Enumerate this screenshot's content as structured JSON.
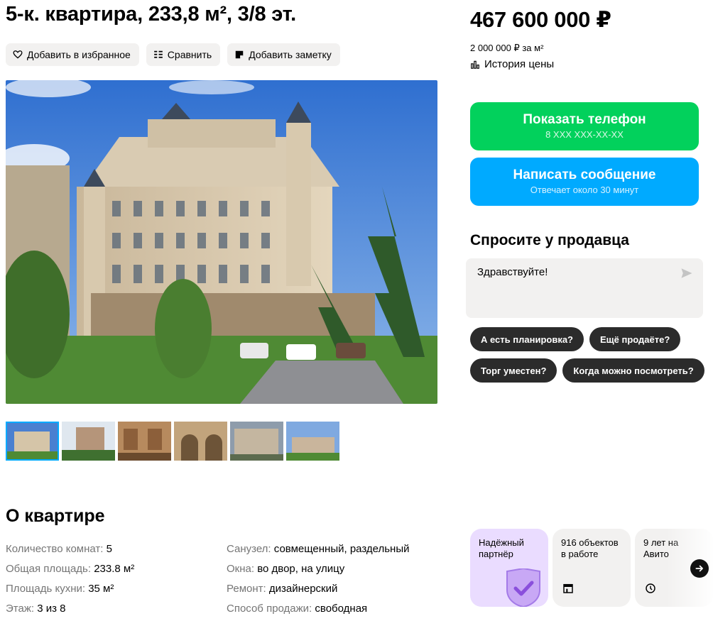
{
  "listing": {
    "title": "5-к. квартира, 233,8 м², 3/8 эт.",
    "actions": {
      "favorite": "Добавить в избранное",
      "compare": "Сравнить",
      "note": "Добавить заметку"
    }
  },
  "price": {
    "total": "467 600 000 ₽",
    "per_m2": "2 000 000 ₽ за м²",
    "history_link": "История цены"
  },
  "contact": {
    "phone_label": "Показать телефон",
    "phone_masked": "8 XXX XXX-XX-XX",
    "message_label": "Написать сообщение",
    "message_sub": "Отвечает около 30 минут"
  },
  "ask": {
    "title": "Спросите у продавца",
    "message_value": "Здравствуйте!",
    "quick_replies": [
      "А есть планировка?",
      "Ещё продаёте?",
      "Торг уместен?",
      "Когда можно посмотреть?"
    ]
  },
  "about": {
    "title": "О квартире",
    "left": [
      {
        "key": "Количество комнат:",
        "value": "5"
      },
      {
        "key": "Общая площадь:",
        "value": "233.8 м²"
      },
      {
        "key": "Площадь кухни:",
        "value": "35 м²"
      },
      {
        "key": "Этаж:",
        "value": "3 из 8"
      }
    ],
    "right": [
      {
        "key": "Санузел:",
        "value": "совмещенный, раздельный"
      },
      {
        "key": "Окна:",
        "value": "во двор, на улицу"
      },
      {
        "key": "Ремонт:",
        "value": "дизайнерский"
      },
      {
        "key": "Способ продажи:",
        "value": "свободная"
      }
    ]
  },
  "seller_badges": [
    {
      "text": "Надёжный партнёр",
      "icon": "shield-check-icon"
    },
    {
      "text": "916 объектов в работе",
      "icon": "building-icon"
    },
    {
      "text": "9 лет на Авито",
      "icon": "clock-icon"
    }
  ],
  "colors": {
    "phone_button": "#02d15c",
    "message_button": "#00aaff",
    "chip": "#2b2b2b",
    "badge_purple": "#eadcff"
  }
}
